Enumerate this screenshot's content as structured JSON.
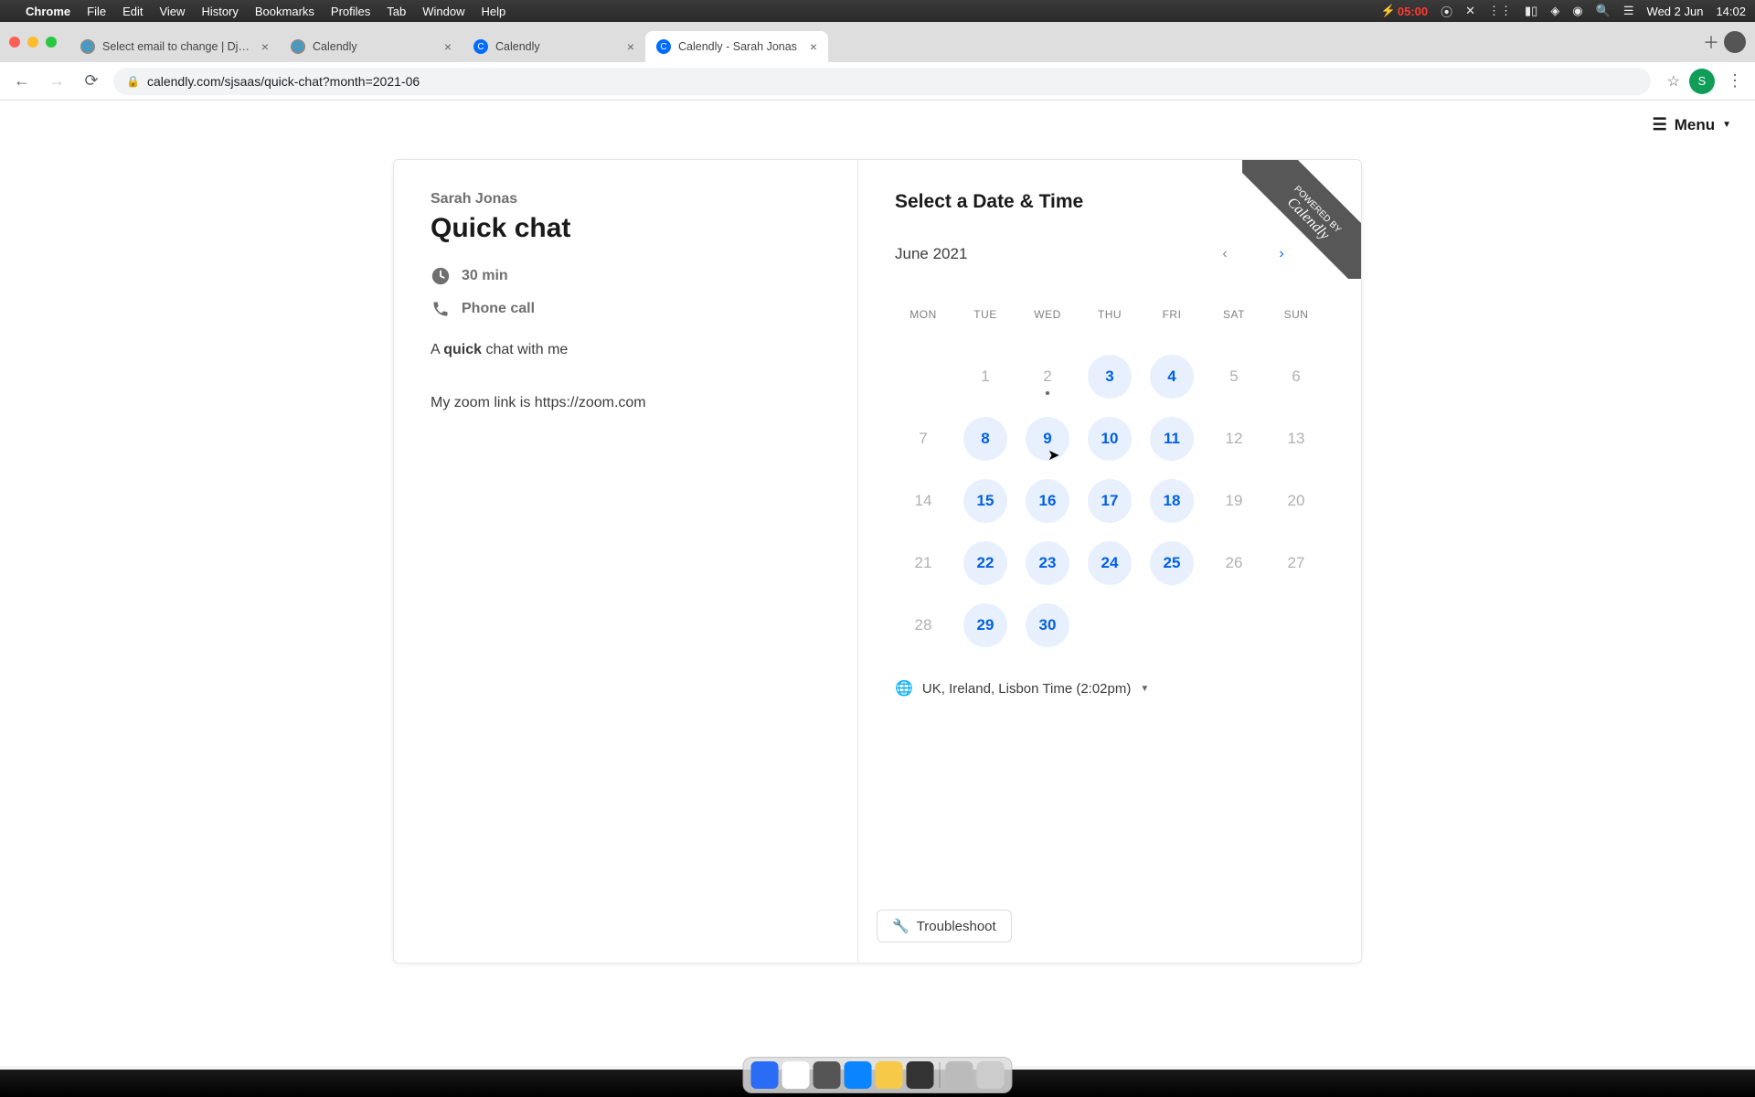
{
  "menubar": {
    "app": "Chrome",
    "items": [
      "File",
      "Edit",
      "View",
      "History",
      "Bookmarks",
      "Profiles",
      "Tab",
      "Window",
      "Help"
    ],
    "battery": "05:00",
    "date": "Wed 2 Jun",
    "time": "14:02"
  },
  "browser": {
    "tabs": [
      {
        "title": "Select email to change | Django",
        "favicon": "globe",
        "active": false
      },
      {
        "title": "Calendly",
        "favicon": "globe",
        "active": false
      },
      {
        "title": "Calendly",
        "favicon": "calendly",
        "active": false
      },
      {
        "title": "Calendly - Sarah Jonas",
        "favicon": "calendly",
        "active": true
      }
    ],
    "url": "calendly.com/sjsaas/quick-chat?month=2021-06",
    "avatar_letter": "S"
  },
  "page": {
    "menu_label": "Menu",
    "ribbon_small": "POWERED BY",
    "ribbon_big": "Calendly"
  },
  "event": {
    "host": "Sarah Jonas",
    "title": "Quick chat",
    "duration": "30 min",
    "location": "Phone call",
    "desc_pre": "A ",
    "desc_bold": "quick",
    "desc_post": " chat with me",
    "desc_line2": "My zoom link is https://zoom.com"
  },
  "calendar": {
    "heading": "Select a Date & Time",
    "month": "June 2021",
    "dow": [
      "MON",
      "TUE",
      "WED",
      "THU",
      "FRI",
      "SAT",
      "SUN"
    ],
    "days": [
      {
        "n": "",
        "s": "blank"
      },
      {
        "n": "1",
        "s": "dis"
      },
      {
        "n": "2",
        "s": "dis",
        "today": true
      },
      {
        "n": "3",
        "s": "avail"
      },
      {
        "n": "4",
        "s": "avail"
      },
      {
        "n": "5",
        "s": "dis"
      },
      {
        "n": "6",
        "s": "dis"
      },
      {
        "n": "7",
        "s": "dis"
      },
      {
        "n": "8",
        "s": "avail"
      },
      {
        "n": "9",
        "s": "avail"
      },
      {
        "n": "10",
        "s": "avail"
      },
      {
        "n": "11",
        "s": "avail"
      },
      {
        "n": "12",
        "s": "dis"
      },
      {
        "n": "13",
        "s": "dis"
      },
      {
        "n": "14",
        "s": "dis"
      },
      {
        "n": "15",
        "s": "avail"
      },
      {
        "n": "16",
        "s": "avail"
      },
      {
        "n": "17",
        "s": "avail"
      },
      {
        "n": "18",
        "s": "avail"
      },
      {
        "n": "19",
        "s": "dis"
      },
      {
        "n": "20",
        "s": "dis"
      },
      {
        "n": "21",
        "s": "dis"
      },
      {
        "n": "22",
        "s": "avail"
      },
      {
        "n": "23",
        "s": "avail"
      },
      {
        "n": "24",
        "s": "avail"
      },
      {
        "n": "25",
        "s": "avail"
      },
      {
        "n": "26",
        "s": "dis"
      },
      {
        "n": "27",
        "s": "dis"
      },
      {
        "n": "28",
        "s": "dis"
      },
      {
        "n": "29",
        "s": "avail"
      },
      {
        "n": "30",
        "s": "avail"
      }
    ],
    "timezone": "UK, Ireland, Lisbon Time (2:02pm)",
    "troubleshoot": "Troubleshoot"
  }
}
